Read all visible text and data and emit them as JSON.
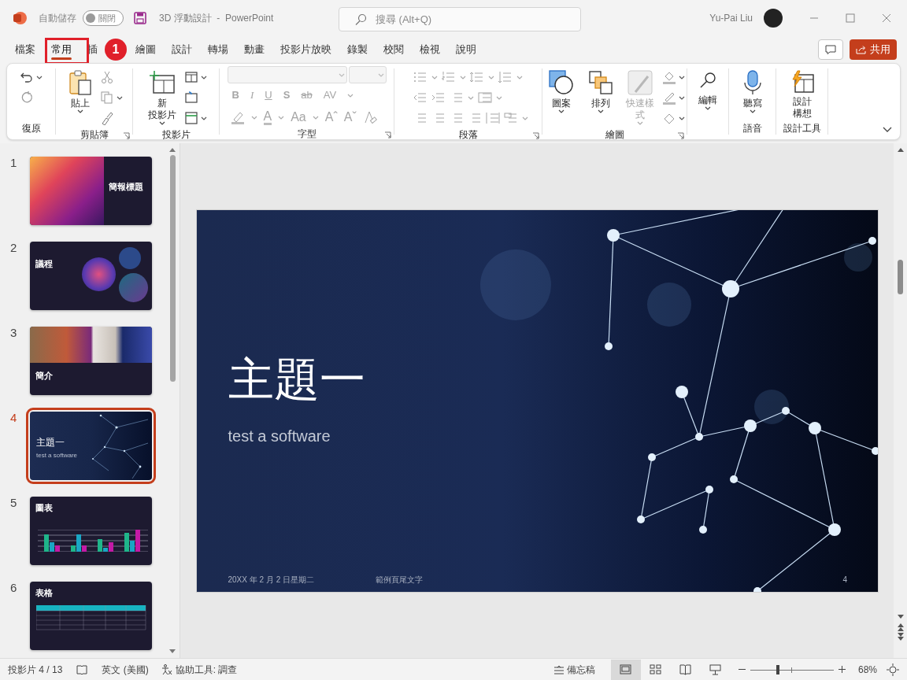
{
  "window": {
    "title": "3D 浮動設計  -  PowerPoint",
    "autosave_label": "自動儲存",
    "autosave": {
      "on": false,
      "label": "關閉"
    },
    "search_placeholder": "搜尋 (Alt+Q)",
    "user_name": "Yu-Pai Liu"
  },
  "tabs": [
    {
      "label": "檔案",
      "selected": false
    },
    {
      "label": "常用",
      "selected": true
    },
    {
      "label": "插",
      "selected": false
    },
    {
      "label": "繪圖",
      "selected": false
    },
    {
      "label": "設計",
      "selected": false
    },
    {
      "label": "轉場",
      "selected": false
    },
    {
      "label": "動畫",
      "selected": false
    },
    {
      "label": "投影片放映",
      "selected": false
    },
    {
      "label": "錄製",
      "selected": false
    },
    {
      "label": "校閱",
      "selected": false
    },
    {
      "label": "檢視",
      "selected": false
    },
    {
      "label": "說明",
      "selected": false
    }
  ],
  "callout": {
    "number": "1"
  },
  "share_label": "共用",
  "ribbon": {
    "groups": [
      {
        "kind": "undo",
        "label": "復原"
      },
      {
        "kind": "clipboard",
        "label": "剪貼簿",
        "button": "貼上"
      },
      {
        "kind": "slides",
        "label": "投影片",
        "button_lines": [
          "新",
          "投影片"
        ]
      },
      {
        "kind": "font",
        "label": "字型",
        "disabled": true,
        "format_keys": [
          "B",
          "I",
          "U",
          "S",
          "ab",
          "AV"
        ],
        "size_keys": [
          "A",
          "Aa",
          "Aˆ",
          "Aˇ"
        ]
      },
      {
        "kind": "paragraph",
        "label": "段落",
        "disabled": true
      },
      {
        "kind": "drawing",
        "label": "繪圖",
        "buttons": [
          {
            "label": "圖案",
            "disabled": false
          },
          {
            "label": "排列",
            "disabled": false
          },
          {
            "label": "快速樣式",
            "disabled": true
          }
        ]
      },
      {
        "kind": "editing",
        "button": "編輯"
      },
      {
        "kind": "voice",
        "label": "語音",
        "button": "聽寫"
      },
      {
        "kind": "designer",
        "label": "設計工具",
        "button": "設計構想"
      }
    ]
  },
  "slides": [
    {
      "number": "1",
      "kind": "title",
      "title": "簡報標題",
      "selected": false
    },
    {
      "number": "2",
      "kind": "agenda",
      "title": "議程",
      "selected": false
    },
    {
      "number": "3",
      "kind": "intro",
      "title": "簡介",
      "selected": false
    },
    {
      "number": "4",
      "kind": "topic",
      "title": "主題一",
      "subtitle": "test a software",
      "selected": true
    },
    {
      "number": "5",
      "kind": "chart",
      "title": "圖表",
      "selected": false
    },
    {
      "number": "6",
      "kind": "table",
      "title": "表格",
      "selected": false
    }
  ],
  "main_slide": {
    "title": "主題一",
    "subtitle": "test a software",
    "date": "20XX 年 2 月 2 日星期二",
    "footer": "範例頁尾文字",
    "number": "4"
  },
  "status_bar": {
    "slide_info": "投影片 4 / 13",
    "language": "英文 (美國)",
    "accessibility": "協助工具: 調查",
    "notes": "備忘稿",
    "views": [
      {
        "kind": "normal",
        "selected": true
      },
      {
        "kind": "sorter",
        "selected": false
      },
      {
        "kind": "reading",
        "selected": false
      },
      {
        "kind": "show",
        "selected": false
      }
    ],
    "zoom": {
      "level": 0.33,
      "label": "68%"
    }
  }
}
